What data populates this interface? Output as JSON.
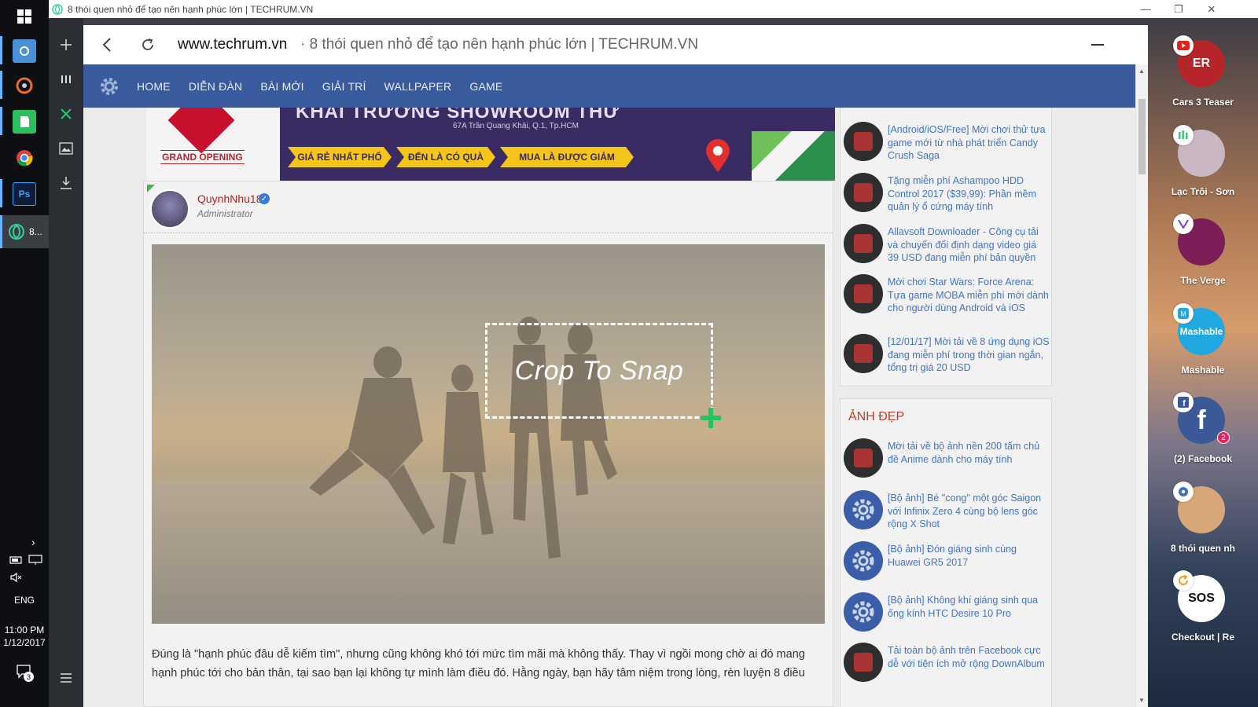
{
  "window": {
    "title": "8 thói quen nhỏ để tạo nên hạnh phúc lớn | TECHRUM.VN"
  },
  "taskbar": {
    "active_app_label": "8...",
    "language": "ENG",
    "time": "11:00 PM",
    "date": "1/12/2017",
    "notification_count": "3",
    "apps": [
      "cortana-icon",
      "cinema-icon",
      "evernote-icon",
      "chrome-icon",
      "photoshop-icon",
      "opera-neon-icon"
    ]
  },
  "browser": {
    "host": "www.techrum.vn",
    "page_title": "· 8 thói quen nhỏ để tạo nên hạnh phúc lớn | TECHRUM.VN"
  },
  "site": {
    "nav": [
      "HOME",
      "DIỄN ĐÀN",
      "BÀI MỚI",
      "GIẢI TRÍ",
      "WALLPAPER",
      "GAME"
    ],
    "banner": {
      "headline": "KHAI TRƯƠNG SHOWROOM THỨ",
      "address": "67A Trần Quang Khải, Q.1, Tp.HCM",
      "grand_opening": "GRAND OPENING",
      "chevrons": [
        "GIÁ RẺ NHẤT PHỐ",
        "ĐẾN LÀ CÓ QUÀ",
        "MUA LÀ ĐƯỢC GIẢM"
      ]
    },
    "post": {
      "author": "QuynhNhu18",
      "role": "Administrator",
      "crop_label": "Crop To Snap",
      "text": "Đúng là \"hạnh phúc đâu dễ kiếm tìm\", nhưng cũng không khó tới mức tìm mãi mà không thấy. Thay vì ngồi mong chờ ai đó mang hạnh phúc tới cho bản thân, tại sao bạn lại không tự mình làm điều đó. Hằng ngày, bạn hãy tâm niệm trong lòng, rèn luyện 8 điều"
    },
    "sidebar_top": [
      "[Android/iOS/Free] Mời chơi thử tựa game mới từ nhà phát triển Candy Crush Saga",
      "Tặng miễn phí Ashampoo HDD Control 2017 ($39,99): Phần mềm quản lý ổ cứng máy tính",
      "Allavsoft Downloader - Công cụ tải và chuyển đổi định dạng video giá 39 USD đang miễn phí bản quyền",
      "Mời chơi Star Wars: Force Arena: Tựa game MOBA miễn phí mới dành cho người dùng Android và iOS",
      "[12/01/17] Mời tải về 8 ứng dụng iOS đang miễn phí trong thời gian ngắn, tổng trị giá 20 USD"
    ],
    "sidebar_heading": "ẢNH ĐẸP",
    "sidebar_bottom": [
      "Mời tải về bộ ảnh nền 200 tấm chủ đề Anime dành cho máy tính",
      "[Bộ ảnh] Bé \"cong\" một góc Saigon với Infinix Zero 4 cùng bộ lens góc rộng X Shot",
      "[Bộ ảnh] Đón giáng sinh cùng Huawei GR5 2017",
      "[Bộ ảnh] Không khí giáng sinh qua ống kính HTC Desire 10 Pro",
      "Tải toàn bộ ảnh trên Facebook cực dễ với tiện ích mở rộng DownAlbum"
    ]
  },
  "rail": {
    "apps": [
      {
        "label": "Cars 3 Teaser",
        "badge": "youtube-icon",
        "circle_text": "ER",
        "color": "#b5252a"
      },
      {
        "label": "Lạc Trôi - Sơn",
        "badge": "music-icon",
        "circle_text": "",
        "color": "#c9b8c4"
      },
      {
        "label": "The Verge",
        "badge": "verge-icon",
        "circle_text": "",
        "color": "#7b1e57"
      },
      {
        "label": "Mashable",
        "badge": "mashable-icon",
        "circle_text": "Mashable",
        "color": "#21a8e0"
      },
      {
        "label": "(2) Facebook",
        "badge": "facebook-icon",
        "circle_text": "f",
        "color": "#3b5998",
        "notifications": "2"
      },
      {
        "label": "8 thói quen nh",
        "badge": "settings-icon",
        "circle_text": "",
        "color": "#d7a77a"
      },
      {
        "label": "Checkout | Re",
        "badge": "refresh-icon",
        "circle_text": "SOS",
        "color": "#ffffff"
      }
    ]
  }
}
